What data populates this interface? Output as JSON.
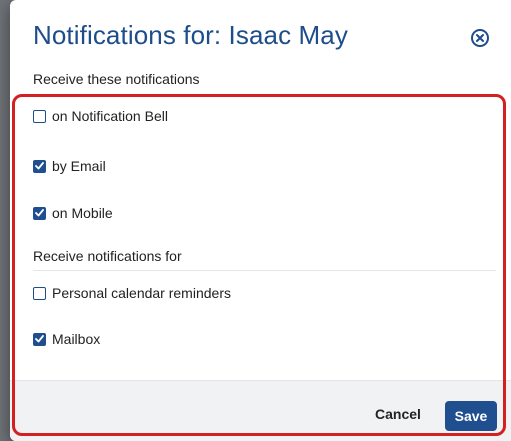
{
  "dialog": {
    "title": "Notifications for: Isaac May"
  },
  "section_channels": {
    "heading": "Receive these notifications",
    "options": [
      {
        "label": "on Notification Bell",
        "checked": false
      },
      {
        "label": "by Email",
        "checked": true
      },
      {
        "label": "on Mobile",
        "checked": true
      }
    ]
  },
  "section_types": {
    "heading": "Receive notifications for",
    "options": [
      {
        "label": "Personal calendar reminders",
        "checked": false
      },
      {
        "label": "Mailbox",
        "checked": true
      }
    ]
  },
  "footer": {
    "cancel_label": "Cancel",
    "save_label": "Save"
  },
  "colors": {
    "title": "#1d4d8a",
    "checkbox_checked": "#1f4f8f",
    "save_button": "#1f4f8f",
    "highlight_border": "#d32020",
    "footer_bg": "#f1f2f4"
  },
  "icons": {
    "close": "close-circle-icon",
    "checkmark": "checkmark-icon"
  }
}
